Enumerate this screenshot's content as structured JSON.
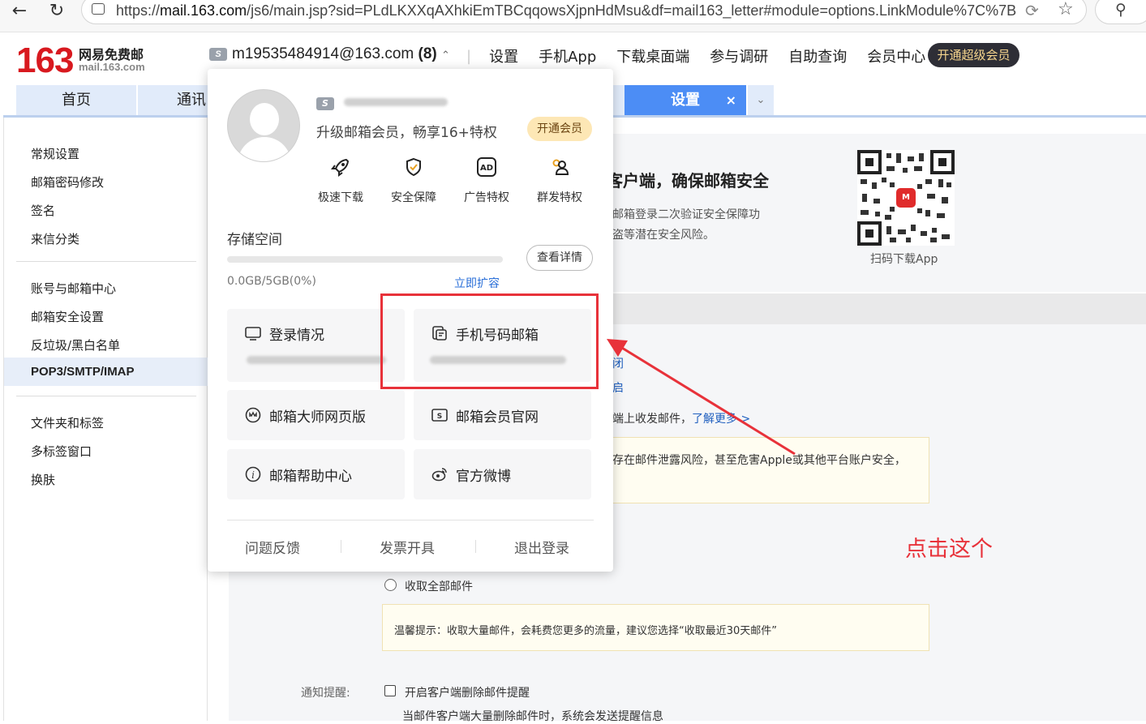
{
  "browser": {
    "url_prefix": "https://",
    "url_host": "mail.163.com",
    "url_rest": "/js6/main.jsp?sid=PLdLKXXqAXhkiEmTBCqqowsXjpnHdMsu&df=mail163_letter#module=options.LinkModule%7C%7B\"su..."
  },
  "header": {
    "logo_number": "163",
    "logo_cn": "网易免费邮",
    "logo_domain": "mail.163.com",
    "account": "m19535484914@163.com",
    "unread": "(8)",
    "nav": [
      "设置",
      "手机App",
      "下载桌面端",
      "参与调研",
      "自助查询",
      "会员中心"
    ],
    "vip_button": "开通超级会员"
  },
  "tabs": {
    "home": "首页",
    "contacts": "通讯录",
    "settings": "设置",
    "close": "×"
  },
  "sidebar": {
    "items": [
      "常规设置",
      "邮箱密码修改",
      "签名",
      "来信分类",
      "账号与邮箱中心",
      "邮箱安全设置",
      "反垃圾/黑白名单",
      "POP3/SMTP/IMAP",
      "文件夹和标签",
      "多标签窗口",
      "换肤"
    ]
  },
  "main": {
    "banner_title": "客户端，确保邮箱安全",
    "banner_desc1": "邮箱登录二次验证安全保障功",
    "banner_desc2": "盗等潜在安全风险。",
    "qr_caption": "扫码下载App",
    "frag_close": "闭",
    "frag_open": "启",
    "frag_sync": "端上收发邮件，",
    "learn_more": "了解更多 >",
    "warning_text": "存在邮件泄露风险，甚至危害Apple或其他平台账户安全，",
    "radio_all": "收取全部邮件",
    "tip_text": "温馨提示：收取大量邮件，会耗费您更多的流量，建议您选择“收取最近30天邮件”",
    "notify_label": "通知提醒:",
    "notify_checkbox": "开启客户端删除邮件提醒",
    "notify_desc": "当邮件客户端大量删除邮件时，系统会发送提醒信息"
  },
  "popup": {
    "upgrade_text": "升级邮箱会员，畅享16+特权",
    "open_vip": "开通会员",
    "perks": [
      "极速下载",
      "安全保障",
      "广告特权",
      "群发特权"
    ],
    "storage_title": "存储空间",
    "storage_usage": "0.0GB/5GB(0%)",
    "storage_fraction": 0.0,
    "storage_details": "查看详情",
    "storage_expand": "立即扩容",
    "cards": {
      "login": "登录情况",
      "phone_mailbox": "手机号码邮箱",
      "master_web": "邮箱大师网页版",
      "vip_site": "邮箱会员官网",
      "help": "邮箱帮助中心",
      "weibo": "官方微博"
    },
    "footer": [
      "问题反馈",
      "发票开具",
      "退出登录"
    ]
  },
  "annotation": {
    "text": "点击这个",
    "color": "#e8323a"
  },
  "colors": {
    "brand_red": "#d8191f",
    "tab_active": "#4c8df5",
    "link_blue": "#2a6fd8"
  }
}
